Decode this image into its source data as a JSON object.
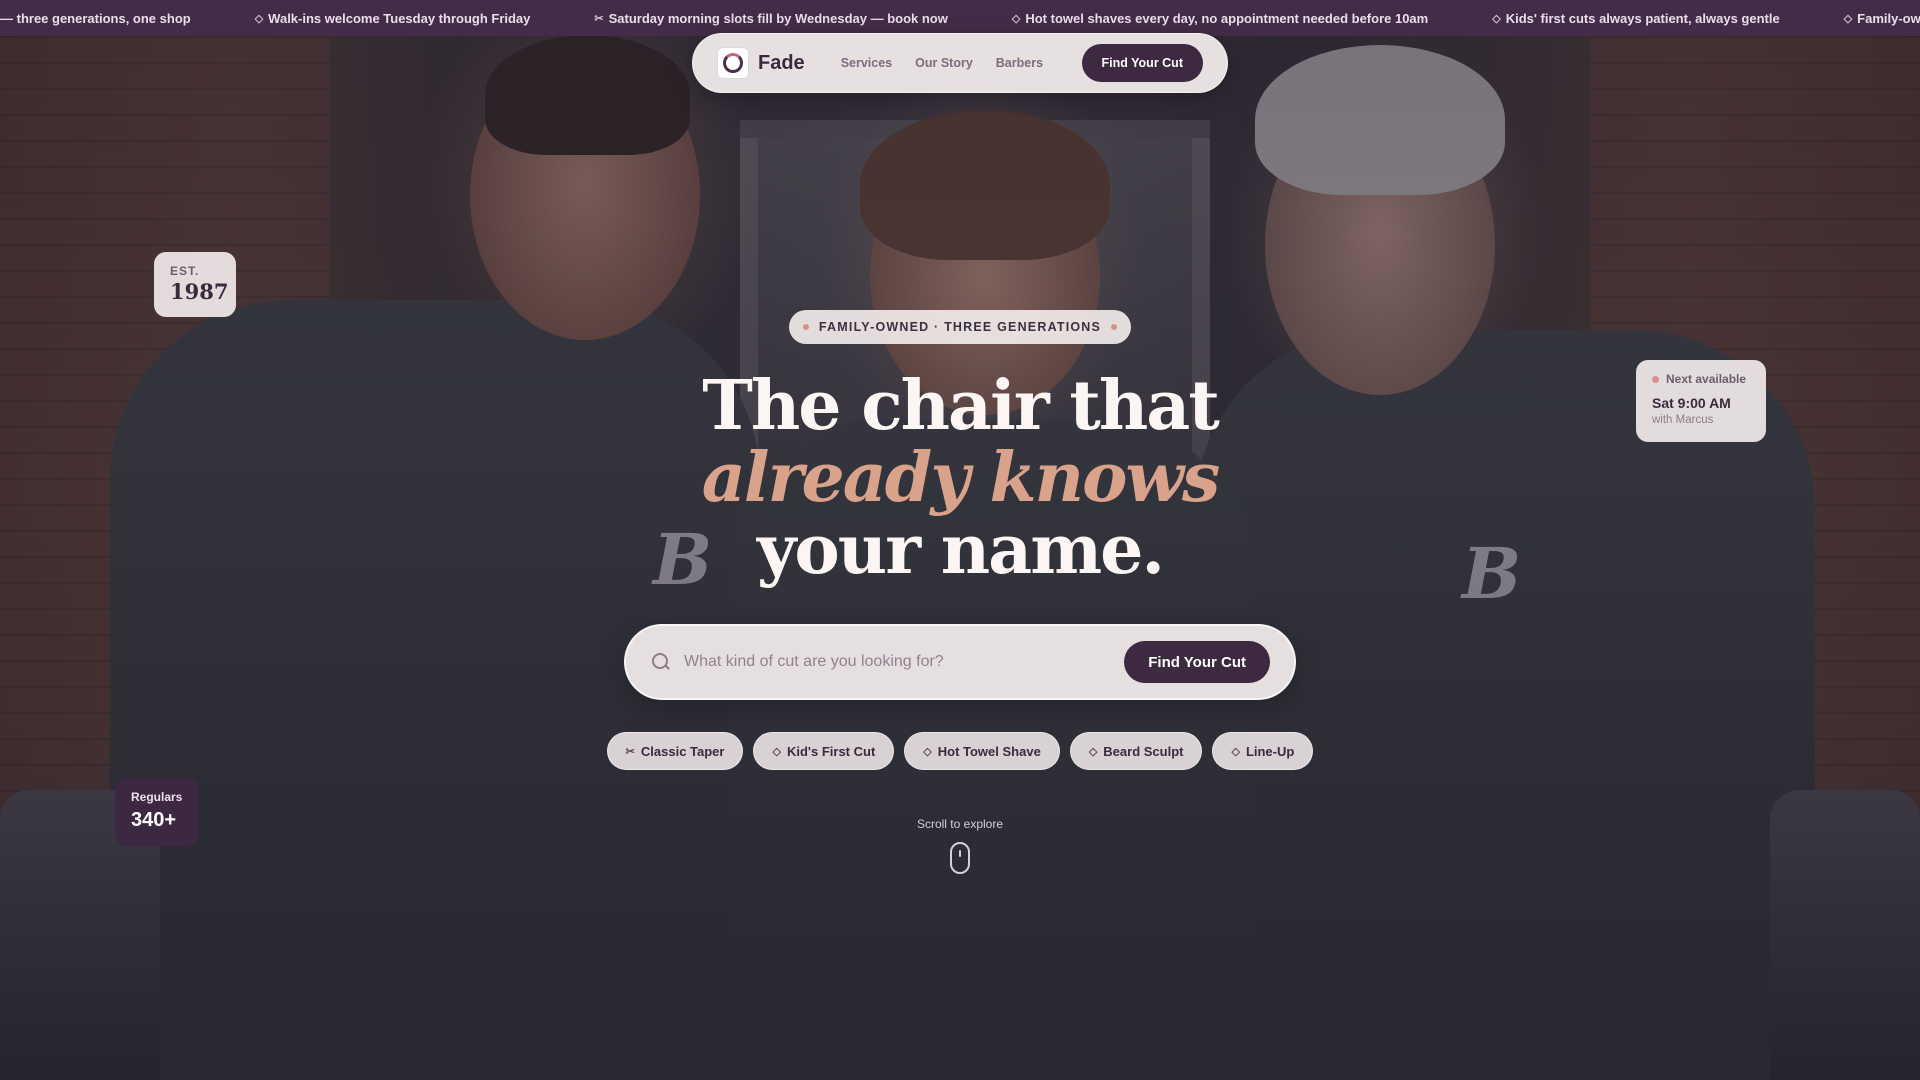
{
  "marquee": {
    "items": [
      {
        "icon": "",
        "text": "— three generations, one shop"
      },
      {
        "icon": "◇",
        "text": "Walk-ins welcome Tuesday through Friday"
      },
      {
        "icon": "✂",
        "text": "Saturday morning slots fill by Wednesday — book now"
      },
      {
        "icon": "◇",
        "text": "Hot towel shaves every day, no appointment needed before 10am"
      },
      {
        "icon": "◇",
        "text": "Kids' first cuts always patient, always gentle"
      },
      {
        "icon": "◇",
        "text": "Family-owned si"
      }
    ]
  },
  "nav": {
    "brand": "Fade",
    "links": [
      "Services",
      "Our Story",
      "Barbers"
    ],
    "cta": "Find Your Cut"
  },
  "est_card": {
    "label": "EST.",
    "year": "1987"
  },
  "next_card": {
    "label": "Next available",
    "time": "Sat 9:00 AM",
    "with": "with Marcus"
  },
  "regulars_card": {
    "label": "Regulars",
    "value": "340+"
  },
  "hero": {
    "tagline": "FAMILY-OWNED · THREE GENERATIONS",
    "headline_line1": "The chair that",
    "headline_line2": "already knows",
    "headline_line3": "your name."
  },
  "search": {
    "placeholder": "What kind of cut are you looking for?",
    "button": "Find Your Cut"
  },
  "chips": [
    {
      "icon": "✂",
      "label": "Classic Taper"
    },
    {
      "icon": "◇",
      "label": "Kid's First Cut"
    },
    {
      "icon": "◇",
      "label": "Hot Towel Shave"
    },
    {
      "icon": "◇",
      "label": "Beard Sculpt"
    },
    {
      "icon": "◇",
      "label": "Line-Up"
    }
  ],
  "scroll_hint": "Scroll to explore",
  "background": {
    "monogram_1": "B",
    "monogram_2": "B"
  },
  "colors": {
    "brand_plum": "#3e2a40",
    "accent_rose": "#d9a28a",
    "marquee_bg": "#432c47"
  }
}
